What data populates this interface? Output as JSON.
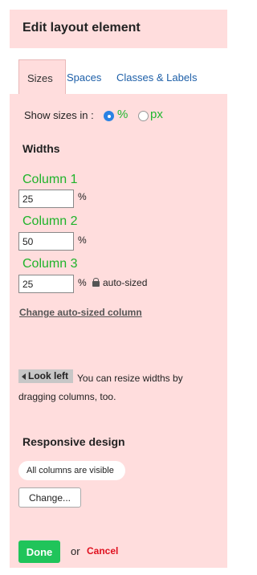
{
  "header": {
    "title": "Edit layout element"
  },
  "tabs": [
    {
      "label": "Sizes",
      "active": true
    },
    {
      "label": "Spaces",
      "active": false
    },
    {
      "label": "Classes & Labels",
      "active": false
    }
  ],
  "sizes": {
    "show_sizes_label": "Show sizes in :",
    "unit_options": [
      {
        "label": "%",
        "selected": true
      },
      {
        "label": "px",
        "selected": false
      }
    ],
    "widths_title": "Widths",
    "columns": [
      {
        "label": "Column 1",
        "value": "25",
        "unit": "%"
      },
      {
        "label": "Column 2",
        "value": "50",
        "unit": "%"
      },
      {
        "label": "Column 3",
        "value": "25",
        "unit": "%",
        "note": "auto-sized"
      }
    ],
    "change_autosized_label": "Change auto-sized column",
    "look_left_label": "Look left",
    "resize_hint": "You can resize widths by dragging columns, too.",
    "responsive_title": "Responsive design",
    "visibility_badge": "All columns are visible",
    "change_button": "Change..."
  },
  "footer": {
    "done_label": "Done",
    "or_label": "or",
    "cancel_label": "Cancel"
  },
  "colors": {
    "panel_bg": "#ffdddd",
    "accent_green": "#1fb32a",
    "link_blue": "#1d5fa8",
    "radio_blue": "#2b82e4",
    "done_green": "#20c45a",
    "cancel_red": "#e0101f"
  },
  "icons": {
    "lock": "lock-icon",
    "look_left_arrow": "caret-left-icon"
  }
}
